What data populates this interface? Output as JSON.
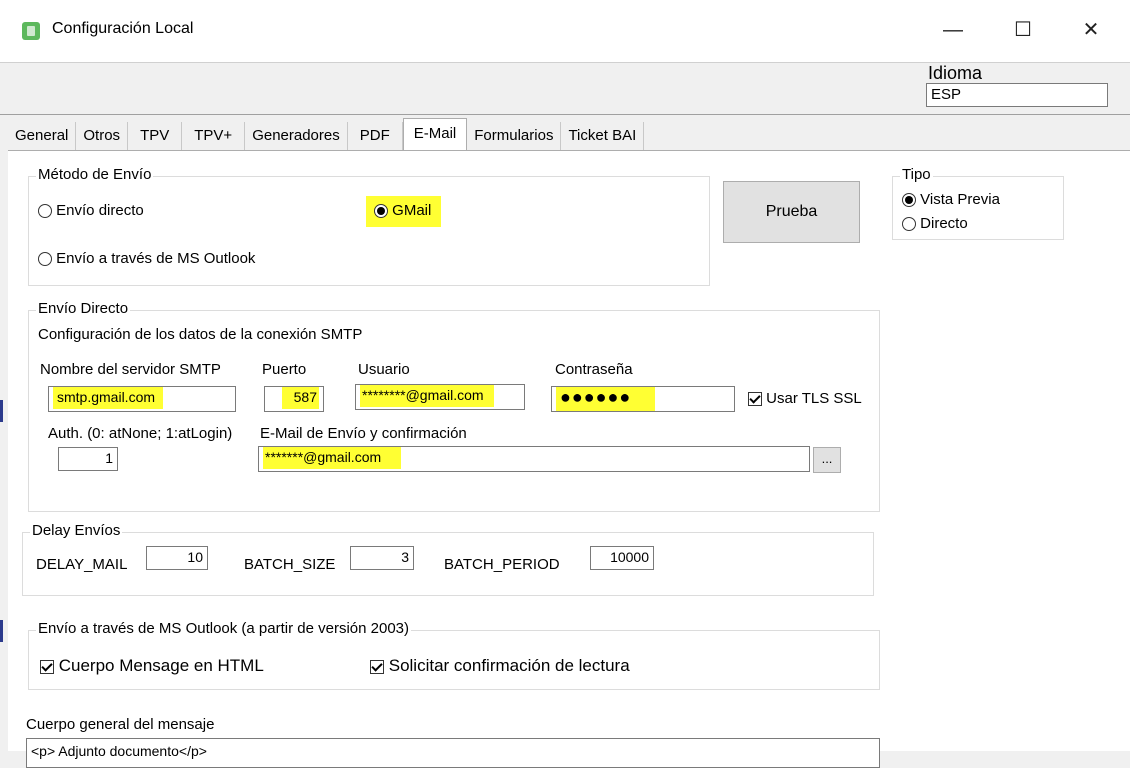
{
  "window": {
    "title": "Configuración Local",
    "minimize": "—",
    "maximize": "☐",
    "close": "✕"
  },
  "idioma": {
    "label": "Idioma",
    "value": "ESP"
  },
  "tabs": [
    "General",
    "Otros",
    "TPV",
    "TPV+",
    "Generadores",
    "PDF",
    "E-Mail",
    "Formularios",
    "Ticket BAI"
  ],
  "active_tab": "E-Mail",
  "metodo": {
    "title": "Método de Envío",
    "options": {
      "directo": "Envío directo",
      "gmail": "GMail",
      "outlook": "Envío a través de MS Outlook"
    },
    "selected": "GMail"
  },
  "prueba_label": "Prueba",
  "tipo": {
    "title": "Tipo",
    "vista_previa": "Vista Previa",
    "directo": "Directo",
    "selected": "Vista Previa"
  },
  "envio_directo": {
    "title": "Envío Directo",
    "subtitle": "Configuración de los datos de la conexión SMTP",
    "smtp_label": "Nombre del servidor SMTP",
    "smtp_value": "smtp.gmail.com",
    "puerto_label": "Puerto",
    "puerto_value": "587",
    "usuario_label": "Usuario",
    "usuario_value": "********@gmail.com",
    "contrasena_label": "Contraseña",
    "contrasena_value": "●●●●●●",
    "tls_label": "Usar TLS SSL",
    "auth_label": "Auth. (0: atNone; 1:atLogin)",
    "auth_value": "1",
    "email_label": "E-Mail de Envío y confirmación",
    "email_value": "*******@gmail.com",
    "browse_label": "..."
  },
  "delay": {
    "title": "Delay Envíos",
    "delay_mail_label": "DELAY_MAIL",
    "delay_mail_value": "10",
    "batch_size_label": "BATCH_SIZE",
    "batch_size_value": "3",
    "batch_period_label": "BATCH_PERIOD",
    "batch_period_value": "10000"
  },
  "outlook": {
    "title": "Envío a través de MS Outlook (a partir de versión 2003)",
    "html_label": "Cuerpo Mensage en HTML",
    "confirm_label": "Solicitar confirmación de lectura"
  },
  "cuerpo": {
    "label": "Cuerpo general del mensaje",
    "value": "<p>  Adjunto documento</p>"
  },
  "colors": {
    "highlight": "#ffff33",
    "app_icon": "#5cb85c"
  }
}
